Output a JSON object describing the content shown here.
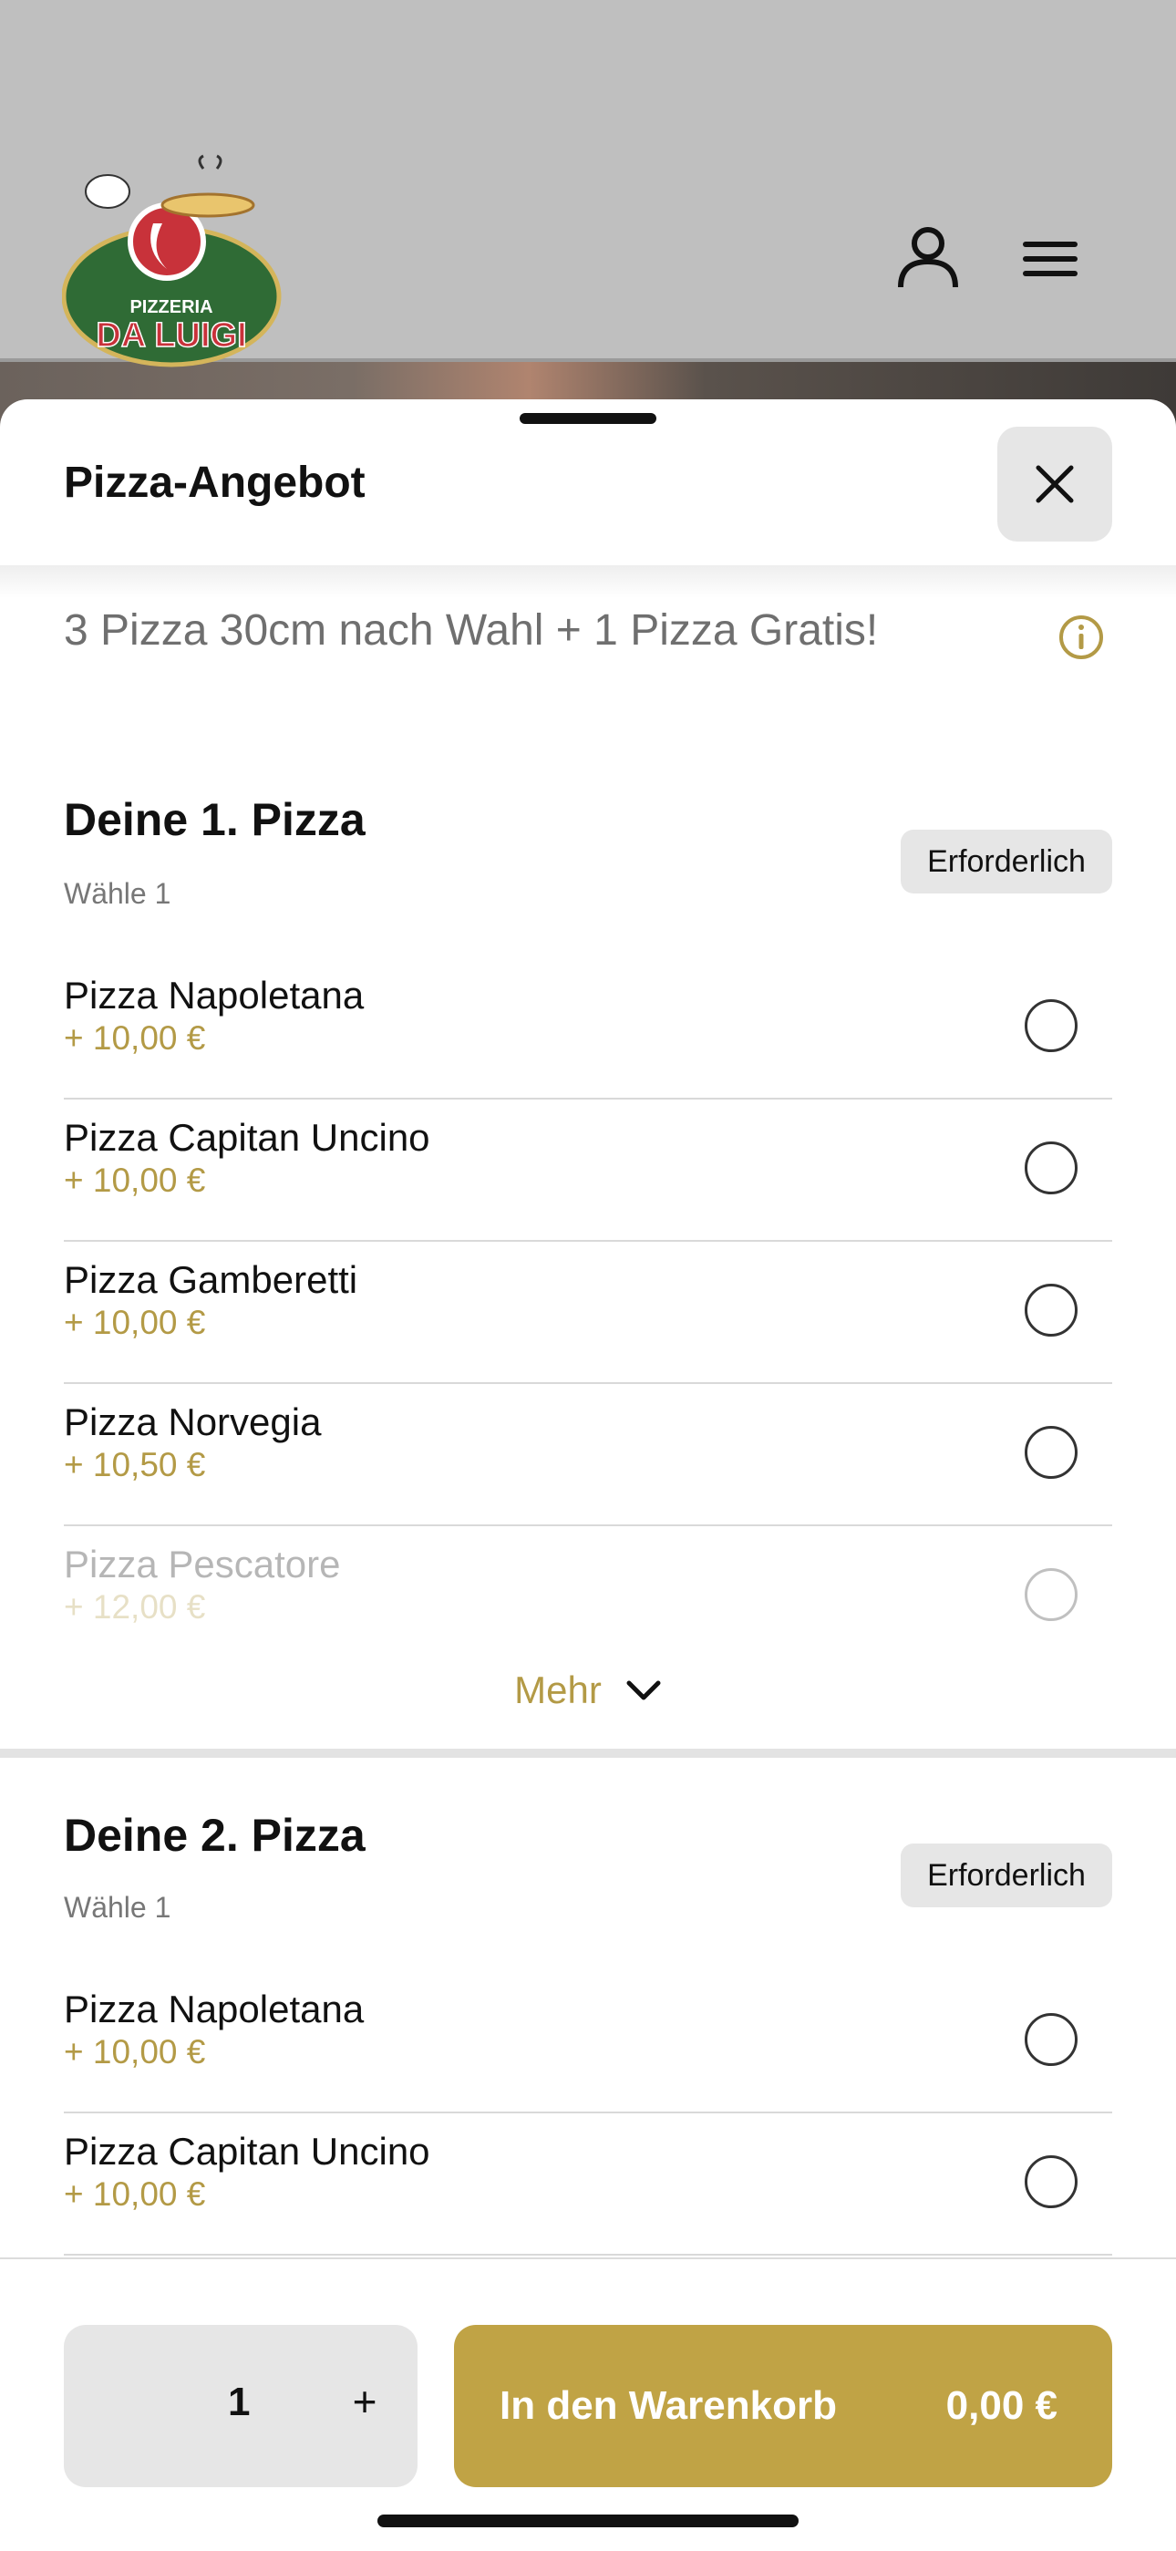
{
  "header": {
    "logo_text_top": "PIZZERIA",
    "logo_text_bottom": "DA LUIGI",
    "account_icon": "person-icon",
    "menu_icon": "hamburger-icon"
  },
  "sheet": {
    "title": "Pizza-Angebot",
    "description": "3 Pizza 30cm nach Wahl + 1 Pizza Gratis!",
    "accent_color": "#c0a345"
  },
  "groups": [
    {
      "title": "Deine 1. Pizza",
      "subtitle": "Wähle 1",
      "badge": "Erforderlich",
      "options": [
        {
          "name": "Pizza Napoletana",
          "price": "+ 10,00 €"
        },
        {
          "name": "Pizza Capitan Uncino",
          "price": "+ 10,00 €"
        },
        {
          "name": "Pizza Gamberetti",
          "price": "+ 10,00 €"
        },
        {
          "name": "Pizza Norvegia",
          "price": "+ 10,50 €"
        },
        {
          "name": "Pizza Pescatore",
          "price": "+ 12,00 €"
        }
      ],
      "more_label": "Mehr"
    },
    {
      "title": "Deine 2. Pizza",
      "subtitle": "Wähle 1",
      "badge": "Erforderlich",
      "options": [
        {
          "name": "Pizza Napoletana",
          "price": "+ 10,00 €"
        },
        {
          "name": "Pizza Capitan Uncino",
          "price": "+ 10,00 €"
        }
      ]
    }
  ],
  "footer": {
    "quantity": "1",
    "plus": "+",
    "cart_label": "In den Warenkorb",
    "cart_price": "0,00 €"
  }
}
